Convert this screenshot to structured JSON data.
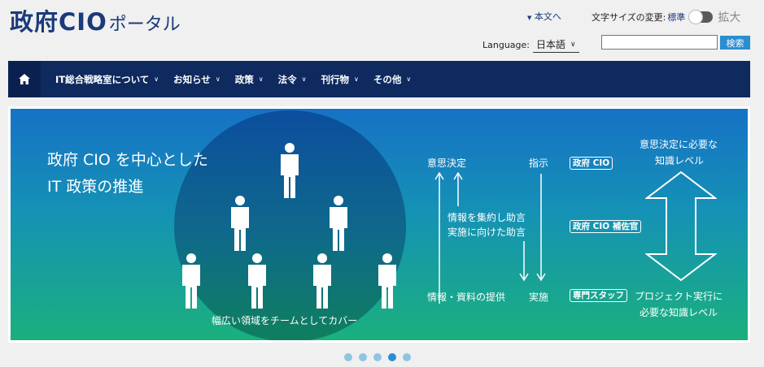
{
  "header": {
    "logo_main": "政府CIO",
    "logo_sub": "ポータル",
    "skip_link": "本文へ",
    "font_size_label": "文字サイズの変更:",
    "font_size_standard": "標準",
    "font_size_large": "拡大",
    "language_label": "Language:",
    "language_value": "日本語",
    "search_placeholder": "",
    "search_button": "検索"
  },
  "nav": {
    "items": [
      {
        "label": "IT総合戦略室について"
      },
      {
        "label": "お知らせ"
      },
      {
        "label": "政策"
      },
      {
        "label": "法令"
      },
      {
        "label": "刊行物"
      },
      {
        "label": "その他"
      }
    ]
  },
  "hero": {
    "title_line1": "政府 CIO を中心とした",
    "title_line2": "IT 政策の推進",
    "circle_caption": "幅広い領域をチームとしてカバー",
    "decision": "意思決定",
    "instruction": "指示",
    "aggregate_line1": "情報を集約し助言",
    "aggregate_line2": "実施に向けた助言",
    "provide": "情報・資料の提供",
    "implement": "実施",
    "role_cio": "政府 CIO",
    "role_deputy": "政府 CIO 補佐官",
    "role_staff": "専門スタッフ",
    "knowledge_top_line1": "意思決定に必要な",
    "knowledge_top_line2": "知識レベル",
    "knowledge_bottom_line1": "プロジェクト実行に",
    "knowledge_bottom_line2": "必要な知識レベル"
  },
  "carousel": {
    "slide_count": 5,
    "active_index": 3
  }
}
